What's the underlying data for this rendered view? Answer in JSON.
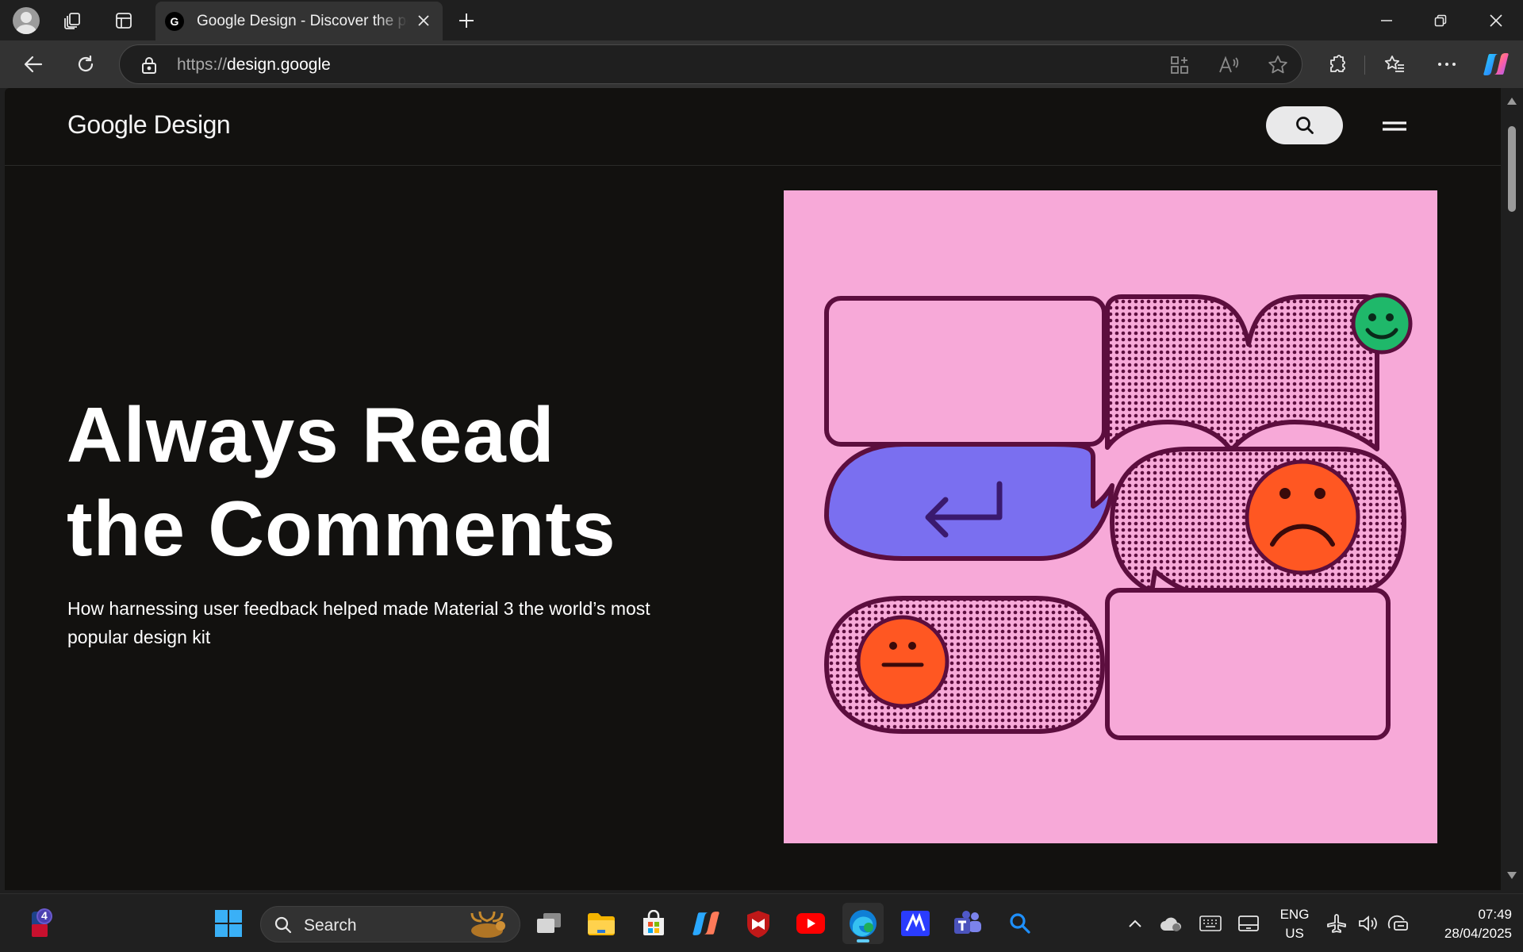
{
  "browser": {
    "tab": {
      "favicon_letter": "G",
      "title": "Google Design - Discover the people, ideas, and tools behind Google Design"
    },
    "address_bar": {
      "url_scheme": "https://",
      "url_host": "design.google"
    }
  },
  "site": {
    "logo_google": "Google",
    "logo_design": "Design",
    "hero": {
      "title_line1": "Always Read",
      "title_line2": "the Comments",
      "subtitle": "How harnessing user feedback helped made Material 3 the world’s most popular design kit"
    }
  },
  "taskbar": {
    "search_label": "Search",
    "language_line1": "ENG",
    "language_line2": "US",
    "time": "07:49",
    "date": "28/04/2025",
    "notification_badge": "4"
  },
  "colors": {
    "page_background": "#12110f",
    "art_pink": "#f7a9d8",
    "art_outline": "#5c0e3e",
    "art_blue": "#7a6ff0",
    "face_orange": "#ff5722",
    "face_green": "#1fb86a",
    "edge_accent": "#60cdff"
  }
}
